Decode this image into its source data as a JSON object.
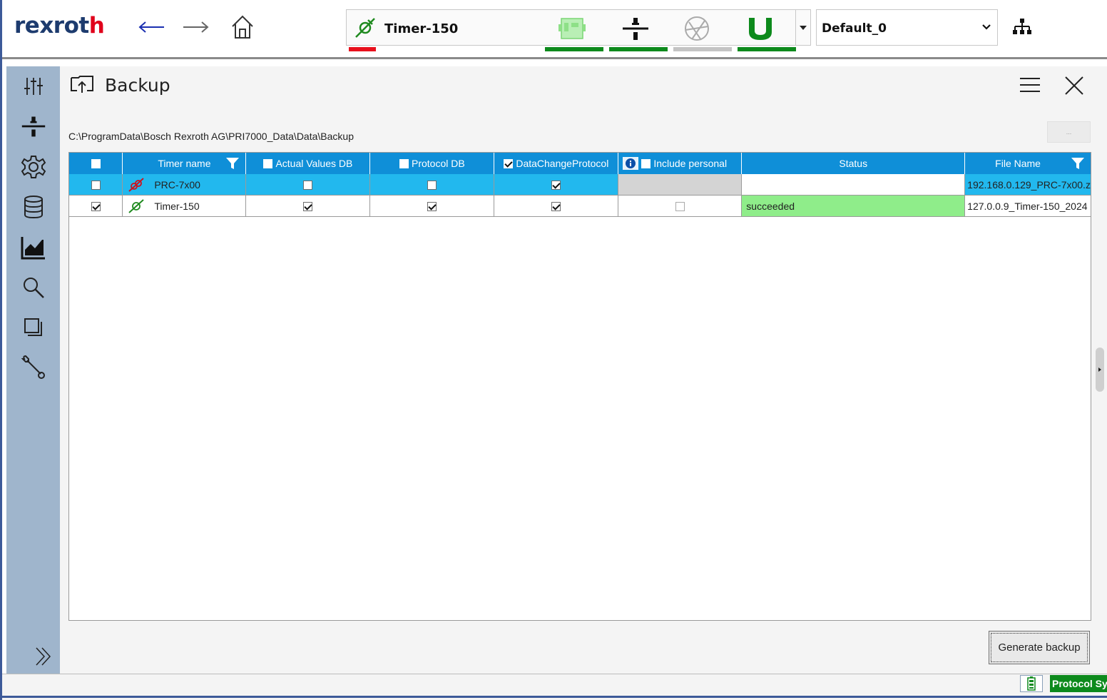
{
  "header": {
    "logo_main": "rexrot",
    "logo_accent": "h",
    "timer_name": "Timer-150",
    "profile_value": "Default_0"
  },
  "page": {
    "title": "Backup",
    "path": "C:\\ProgramData\\Bosch Rexroth AG\\PRI7000_Data\\Data\\Backup",
    "browse_label": "...",
    "generate_label": "Generate backup"
  },
  "table": {
    "columns": [
      "Timer name",
      "Actual Values DB",
      "Protocol DB",
      "DataChangeProtocol",
      "Include personal",
      "Status",
      "File Name"
    ],
    "rows": [
      {
        "timer": "PRC-7x00",
        "status": "",
        "file": "192.168.0.129_PRC-7x00.z"
      },
      {
        "timer": "Timer-150",
        "status": "succeeded",
        "file": "127.0.0.9_Timer-150_2024"
      }
    ]
  },
  "statusbar": {
    "protocol_label": "Protocol Sy"
  },
  "colors": {
    "header_blue": "#0f8fd8",
    "selected_row": "#22b8ee",
    "success_green": "#8fed8a",
    "sidebar": "#9fb5cc",
    "status_green": "#0d8a1c",
    "status_red": "#e8101c"
  },
  "icons": [
    "arrow-left-icon",
    "arrow-right-icon",
    "home-icon",
    "connection-plug-icon",
    "network-tree-icon",
    "sliders-icon",
    "spindle-icon",
    "gear-icon",
    "database-icon",
    "chart-icon",
    "search-icon",
    "layers-icon",
    "wrench-icon",
    "double-chevron-icon",
    "menu-icon",
    "close-icon",
    "filter-icon",
    "info-icon"
  ]
}
